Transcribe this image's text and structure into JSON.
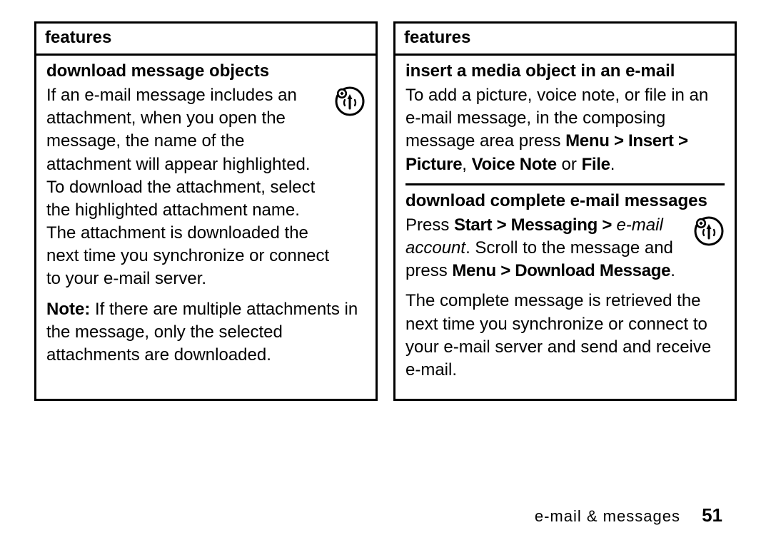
{
  "leftPanel": {
    "header": "features",
    "download": {
      "heading": "download message objects",
      "p1": "If an e-mail message includes an attachment, when you open the message, the name of the attachment will appear highlighted. To download the attachment, select the highlighted attachment name. The attachment is downloaded the next time you synchronize or connect to your e-mail server.",
      "noteLabel": "Note:",
      "noteRest": " If there are multiple attachments in the message, only the selected attachments are downloaded."
    }
  },
  "rightPanel": {
    "header": "features",
    "insert": {
      "heading": "insert a media object in an e-mail",
      "txt1": "To add a picture, voice note, or file in an e-mail message, in the composing message area press ",
      "menuPath": "Menu > Insert > Picture",
      "commaSpace": ", ",
      "voiceNote": "Voice Note",
      "orWord": " or ",
      "file": "File",
      "period": "."
    },
    "downloadComplete": {
      "heading": "download complete e-mail messages",
      "pressWord": "Press ",
      "startMsg": "Start > Messaging > ",
      "emailAccount": "e-mail account",
      "afterAccount": ". Scroll to the message and press ",
      "menuDownload": "Menu > Download Message",
      "period": ".",
      "p2": "The complete message is retrieved the next time you synchronize or connect to your e-mail server and send and receive e-mail."
    }
  },
  "footer": {
    "section": "e-mail & messages",
    "page": "51"
  }
}
